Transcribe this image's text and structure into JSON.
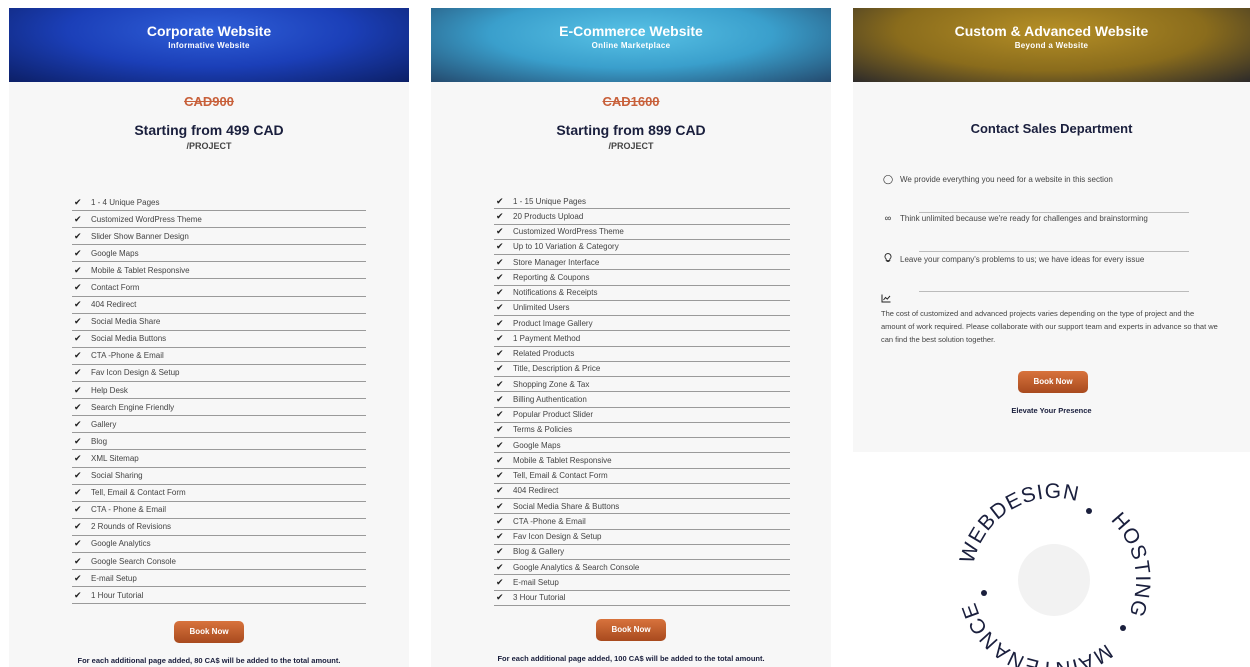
{
  "corporate": {
    "title": "Corporate Website",
    "subtitle": "Informative Website",
    "old_price": "CAD900",
    "price": "Starting from 499 CAD",
    "per": "/PROJECT",
    "features": [
      "1 - 4 Unique Pages",
      "Customized WordPress Theme",
      "Slider Show Banner Design",
      "Google Maps",
      "Mobile & Tablet Responsive",
      "Contact Form",
      "404 Redirect",
      "Social Media Share",
      "Social Media Buttons",
      "CTA -Phone & Email",
      "Fav Icon Design & Setup",
      "Help Desk",
      "Search Engine Friendly",
      "Gallery",
      "Blog",
      "XML Sitemap",
      "Social Sharing",
      "Tell, Email & Contact Form",
      "CTA - Phone & Email",
      "2 Rounds of Revisions",
      "Google Analytics",
      "Google Search Console",
      "E-mail Setup",
      "1 Hour Tutorial"
    ],
    "book_label": "Book Now",
    "note": "For each additional page added, 80 CA$ will be added to the total amount."
  },
  "ecommerce": {
    "title": "E-Commerce Website",
    "subtitle": "Online Marketplace",
    "old_price": "CAD1600",
    "price": "Starting from 899 CAD",
    "per": "/PROJECT",
    "features": [
      "1 - 15 Unique Pages",
      "20 Products Upload",
      "Customized WordPress Theme",
      "Up to 10 Variation & Category",
      "Store Manager Interface",
      "Reporting & Coupons",
      "Notifications & Receipts",
      "Unlimited Users",
      "Product Image Gallery",
      "1 Payment Method",
      "Related Products",
      "Title, Description & Price",
      "Shopping Zone & Tax",
      "Billing Authentication",
      "Popular Product Slider",
      "Terms & Policies",
      "Google Maps",
      "Mobile & Tablet Responsive",
      "Tell, Email & Contact Form",
      "404 Redirect",
      "Social Media Share & Buttons",
      "CTA -Phone & Email",
      "Fav Icon Design & Setup",
      "Blog & Gallery",
      "Google Analytics & Search Console",
      "E-mail Setup",
      "3 Hour Tutorial"
    ],
    "book_label": "Book Now",
    "note": "For each additional page added, 100 CA$ will be added to the total amount."
  },
  "custom": {
    "title": "Custom & Advanced Website",
    "subtitle": "Beyond a Website",
    "contact_title": "Contact Sales Department",
    "rows": [
      {
        "icon": "circle-icon",
        "text": "We provide everything you need for a website in this section"
      },
      {
        "icon": "infinity-icon",
        "text": "Think unlimited because we're ready for challenges and brainstorming"
      },
      {
        "icon": "lightbulb-icon",
        "text": "Leave your company's problems to us; we have ideas for every issue"
      }
    ],
    "paragraph": "The cost of customized and advanced projects varies depending on the type of project and the amount of work required. Please collaborate with our support team and experts in advance so that we can find the best solution together.",
    "book_label": "Book Now",
    "elevate": "Elevate Your Presence"
  },
  "badge": {
    "words": [
      "WEBDESIGN",
      "HOSTING",
      "MAINTENANCE"
    ]
  },
  "colors": {
    "accent": "#c8603a",
    "button": "#b8542a",
    "navy": "#1a1f3d"
  }
}
